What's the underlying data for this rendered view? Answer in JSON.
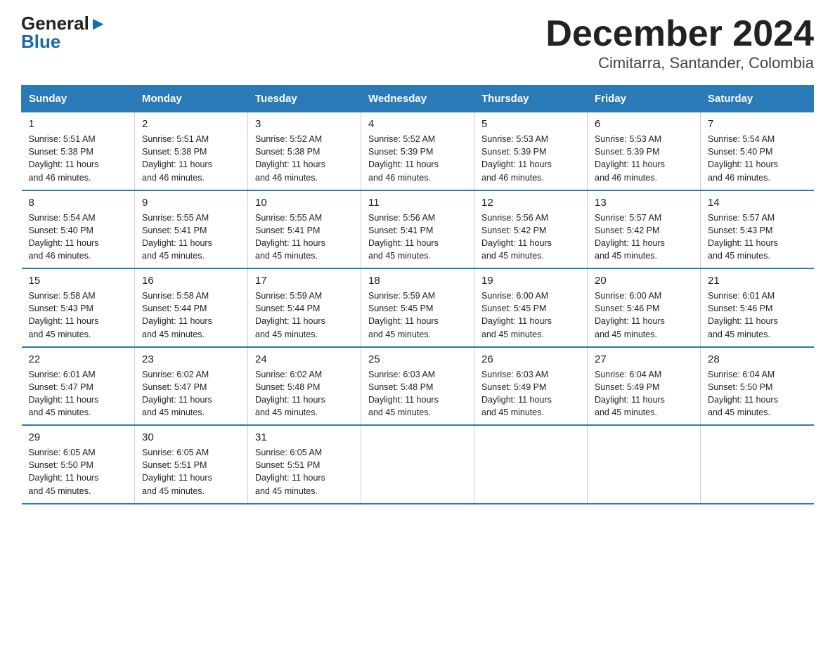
{
  "header": {
    "logo_line1": "General",
    "logo_line2": "Blue",
    "title": "December 2024",
    "subtitle": "Cimitarra, Santander, Colombia"
  },
  "weekdays": [
    "Sunday",
    "Monday",
    "Tuesday",
    "Wednesday",
    "Thursday",
    "Friday",
    "Saturday"
  ],
  "weeks": [
    [
      {
        "day": "1",
        "info": "Sunrise: 5:51 AM\nSunset: 5:38 PM\nDaylight: 11 hours\nand 46 minutes."
      },
      {
        "day": "2",
        "info": "Sunrise: 5:51 AM\nSunset: 5:38 PM\nDaylight: 11 hours\nand 46 minutes."
      },
      {
        "day": "3",
        "info": "Sunrise: 5:52 AM\nSunset: 5:38 PM\nDaylight: 11 hours\nand 46 minutes."
      },
      {
        "day": "4",
        "info": "Sunrise: 5:52 AM\nSunset: 5:39 PM\nDaylight: 11 hours\nand 46 minutes."
      },
      {
        "day": "5",
        "info": "Sunrise: 5:53 AM\nSunset: 5:39 PM\nDaylight: 11 hours\nand 46 minutes."
      },
      {
        "day": "6",
        "info": "Sunrise: 5:53 AM\nSunset: 5:39 PM\nDaylight: 11 hours\nand 46 minutes."
      },
      {
        "day": "7",
        "info": "Sunrise: 5:54 AM\nSunset: 5:40 PM\nDaylight: 11 hours\nand 46 minutes."
      }
    ],
    [
      {
        "day": "8",
        "info": "Sunrise: 5:54 AM\nSunset: 5:40 PM\nDaylight: 11 hours\nand 46 minutes."
      },
      {
        "day": "9",
        "info": "Sunrise: 5:55 AM\nSunset: 5:41 PM\nDaylight: 11 hours\nand 45 minutes."
      },
      {
        "day": "10",
        "info": "Sunrise: 5:55 AM\nSunset: 5:41 PM\nDaylight: 11 hours\nand 45 minutes."
      },
      {
        "day": "11",
        "info": "Sunrise: 5:56 AM\nSunset: 5:41 PM\nDaylight: 11 hours\nand 45 minutes."
      },
      {
        "day": "12",
        "info": "Sunrise: 5:56 AM\nSunset: 5:42 PM\nDaylight: 11 hours\nand 45 minutes."
      },
      {
        "day": "13",
        "info": "Sunrise: 5:57 AM\nSunset: 5:42 PM\nDaylight: 11 hours\nand 45 minutes."
      },
      {
        "day": "14",
        "info": "Sunrise: 5:57 AM\nSunset: 5:43 PM\nDaylight: 11 hours\nand 45 minutes."
      }
    ],
    [
      {
        "day": "15",
        "info": "Sunrise: 5:58 AM\nSunset: 5:43 PM\nDaylight: 11 hours\nand 45 minutes."
      },
      {
        "day": "16",
        "info": "Sunrise: 5:58 AM\nSunset: 5:44 PM\nDaylight: 11 hours\nand 45 minutes."
      },
      {
        "day": "17",
        "info": "Sunrise: 5:59 AM\nSunset: 5:44 PM\nDaylight: 11 hours\nand 45 minutes."
      },
      {
        "day": "18",
        "info": "Sunrise: 5:59 AM\nSunset: 5:45 PM\nDaylight: 11 hours\nand 45 minutes."
      },
      {
        "day": "19",
        "info": "Sunrise: 6:00 AM\nSunset: 5:45 PM\nDaylight: 11 hours\nand 45 minutes."
      },
      {
        "day": "20",
        "info": "Sunrise: 6:00 AM\nSunset: 5:46 PM\nDaylight: 11 hours\nand 45 minutes."
      },
      {
        "day": "21",
        "info": "Sunrise: 6:01 AM\nSunset: 5:46 PM\nDaylight: 11 hours\nand 45 minutes."
      }
    ],
    [
      {
        "day": "22",
        "info": "Sunrise: 6:01 AM\nSunset: 5:47 PM\nDaylight: 11 hours\nand 45 minutes."
      },
      {
        "day": "23",
        "info": "Sunrise: 6:02 AM\nSunset: 5:47 PM\nDaylight: 11 hours\nand 45 minutes."
      },
      {
        "day": "24",
        "info": "Sunrise: 6:02 AM\nSunset: 5:48 PM\nDaylight: 11 hours\nand 45 minutes."
      },
      {
        "day": "25",
        "info": "Sunrise: 6:03 AM\nSunset: 5:48 PM\nDaylight: 11 hours\nand 45 minutes."
      },
      {
        "day": "26",
        "info": "Sunrise: 6:03 AM\nSunset: 5:49 PM\nDaylight: 11 hours\nand 45 minutes."
      },
      {
        "day": "27",
        "info": "Sunrise: 6:04 AM\nSunset: 5:49 PM\nDaylight: 11 hours\nand 45 minutes."
      },
      {
        "day": "28",
        "info": "Sunrise: 6:04 AM\nSunset: 5:50 PM\nDaylight: 11 hours\nand 45 minutes."
      }
    ],
    [
      {
        "day": "29",
        "info": "Sunrise: 6:05 AM\nSunset: 5:50 PM\nDaylight: 11 hours\nand 45 minutes."
      },
      {
        "day": "30",
        "info": "Sunrise: 6:05 AM\nSunset: 5:51 PM\nDaylight: 11 hours\nand 45 minutes."
      },
      {
        "day": "31",
        "info": "Sunrise: 6:05 AM\nSunset: 5:51 PM\nDaylight: 11 hours\nand 45 minutes."
      },
      {
        "day": "",
        "info": ""
      },
      {
        "day": "",
        "info": ""
      },
      {
        "day": "",
        "info": ""
      },
      {
        "day": "",
        "info": ""
      }
    ]
  ]
}
